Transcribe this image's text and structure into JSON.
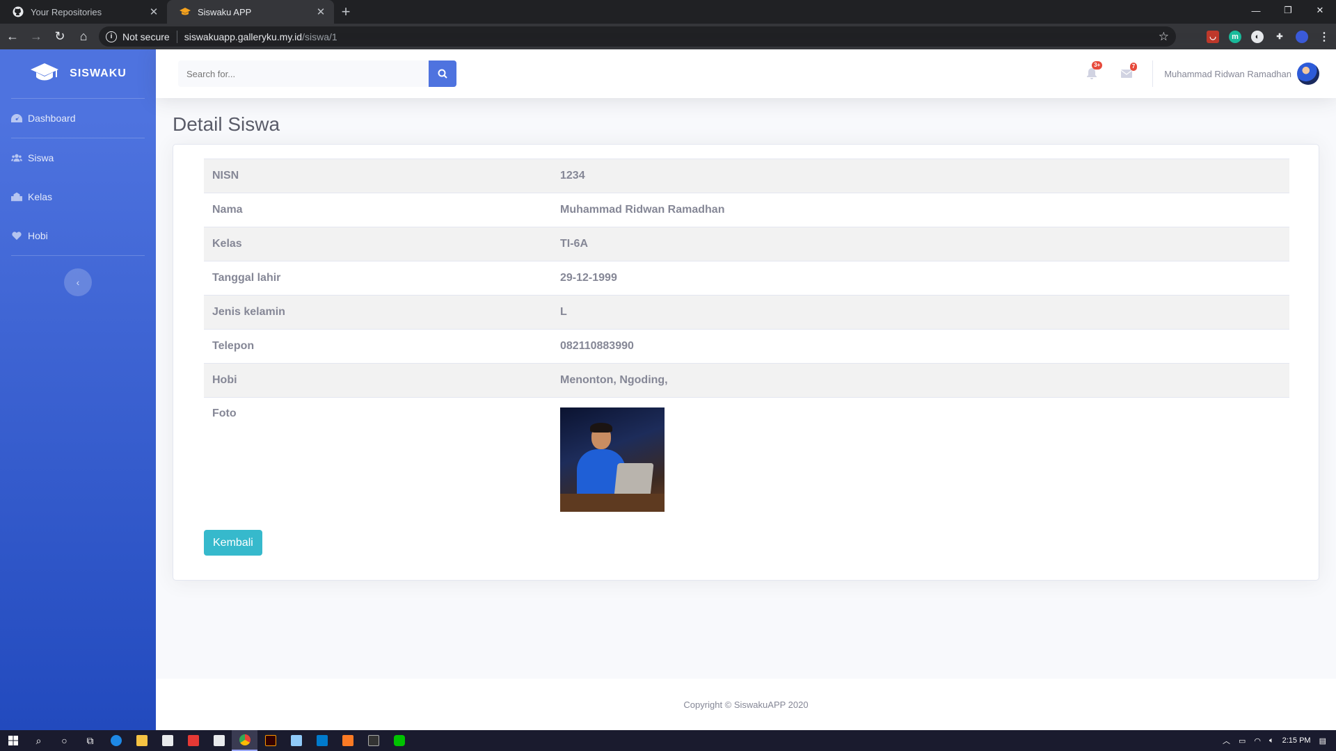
{
  "browser": {
    "tabs": [
      {
        "title": "Your Repositories",
        "active": false,
        "icon": "github-icon"
      },
      {
        "title": "Siswaku APP",
        "active": true,
        "icon": "graduation-cap-icon"
      }
    ],
    "security_label": "Not secure",
    "url_host": "siswakuapp.galleryku.my.id",
    "url_path": "/siswa/1"
  },
  "sidebar": {
    "brand": "SISWAKU",
    "items": [
      {
        "label": "Dashboard",
        "icon": "tachometer-icon"
      },
      {
        "label": "Siswa",
        "icon": "users-icon"
      },
      {
        "label": "Kelas",
        "icon": "school-icon"
      },
      {
        "label": "Hobi",
        "icon": "heart-icon"
      }
    ]
  },
  "topbar": {
    "search_placeholder": "Search for...",
    "alerts_count": "3+",
    "messages_count": "7",
    "user_name": "Muhammad Ridwan Ramadhan"
  },
  "page": {
    "title": "Detail Siswa",
    "details": [
      {
        "label": "NISN",
        "value": "1234"
      },
      {
        "label": "Nama",
        "value": "Muhammad Ridwan Ramadhan"
      },
      {
        "label": "Kelas",
        "value": "TI-6A"
      },
      {
        "label": "Tanggal lahir",
        "value": "29-12-1999"
      },
      {
        "label": "Jenis kelamin",
        "value": "L"
      },
      {
        "label": "Telepon",
        "value": "082110883990"
      },
      {
        "label": "Hobi",
        "value": "Menonton, Ngoding,"
      }
    ],
    "photo_label": "Foto",
    "back_button": "Kembali"
  },
  "footer": {
    "copyright": "Copyright © SiswakuAPP 2020"
  },
  "taskbar": {
    "time": "2:15 PM"
  },
  "colors": {
    "primary": "#4e73df",
    "info": "#36b9cc",
    "danger": "#e74a3b"
  }
}
